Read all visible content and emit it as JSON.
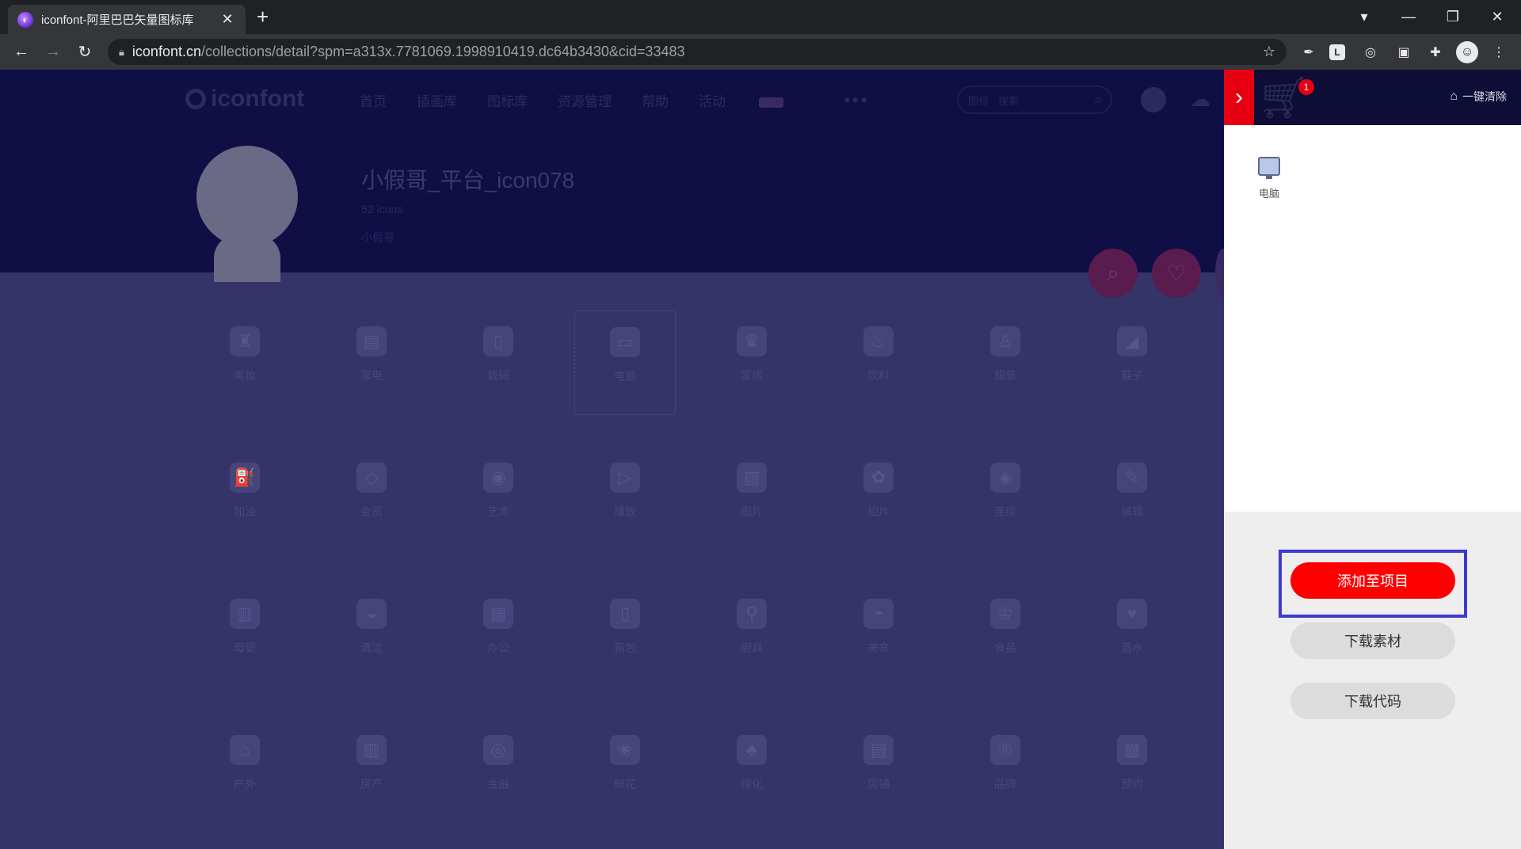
{
  "browser": {
    "tab_title": "iconfont-阿里巴巴矢量图标库",
    "url_host": "iconfont.cn",
    "url_path": "/collections/detail?spm=a313x.7781069.1998910419.dc64b3430&cid=33483"
  },
  "site": {
    "logo": "iconfont",
    "nav": [
      "首页",
      "插画库",
      "图标库",
      "资源管理",
      "帮助",
      "活动"
    ],
    "nav_badge": "NEW",
    "nav_more": "•••",
    "search_type": "图标",
    "search_placeholder": "搜索"
  },
  "collection": {
    "title": "小假哥_平台_icon078",
    "count": "52 icons",
    "author": "小假哥"
  },
  "icons": [
    {
      "label": "美妆",
      "icon": "makeup-icon"
    },
    {
      "label": "家电",
      "icon": "appliance-icon"
    },
    {
      "label": "数码",
      "icon": "digital-icon"
    },
    {
      "label": "电脑",
      "icon": "computer-icon"
    },
    {
      "label": "家居",
      "icon": "furniture-icon"
    },
    {
      "label": "饮料",
      "icon": "drink-icon"
    },
    {
      "label": "服装",
      "icon": "clothing-icon"
    },
    {
      "label": "鞋子",
      "icon": "shoes-icon"
    },
    {
      "label": "加油",
      "icon": "fuel-icon"
    },
    {
      "label": "会员",
      "icon": "diamond-icon"
    },
    {
      "label": "艺术",
      "icon": "palette-icon"
    },
    {
      "label": "播放",
      "icon": "play-icon"
    },
    {
      "label": "图片",
      "icon": "image-icon"
    },
    {
      "label": "相片",
      "icon": "flower-icon"
    },
    {
      "label": "连续",
      "icon": "continuous-icon"
    },
    {
      "label": "编辑",
      "icon": "edit-icon"
    },
    {
      "label": "母婴",
      "icon": "baby-bottle-icon"
    },
    {
      "label": "清洁",
      "icon": "cleaning-icon"
    },
    {
      "label": "办公",
      "icon": "briefcase-icon"
    },
    {
      "label": "箱包",
      "icon": "luggage-icon"
    },
    {
      "label": "厨具",
      "icon": "kitchenware-icon"
    },
    {
      "label": "美食",
      "icon": "food-cover-icon"
    },
    {
      "label": "食品",
      "icon": "cupcake-icon"
    },
    {
      "label": "酒水",
      "icon": "wine-icon"
    },
    {
      "label": "户外",
      "icon": "tent-icon"
    },
    {
      "label": "房产",
      "icon": "building-icon"
    },
    {
      "label": "金融",
      "icon": "coin-icon"
    },
    {
      "label": "鲜花",
      "icon": "bouquet-icon"
    },
    {
      "label": "绿化",
      "icon": "tree-icon"
    },
    {
      "label": "店铺",
      "icon": "store-icon"
    },
    {
      "label": "品牌",
      "icon": "brand-icon"
    },
    {
      "label": "预约",
      "icon": "appointment-icon"
    }
  ],
  "selected_icon": "电脑",
  "cart": {
    "badge": "1",
    "clear_label": "一键清除",
    "items": [
      {
        "label": "电脑",
        "icon": "computer-icon"
      }
    ],
    "add_to_project": "添加至项目",
    "download_material": "下载素材",
    "download_code": "下载代码"
  },
  "colors": {
    "accent_red": "#ff0000",
    "highlight_border": "#3b3bcf",
    "overlay": "#343468"
  }
}
